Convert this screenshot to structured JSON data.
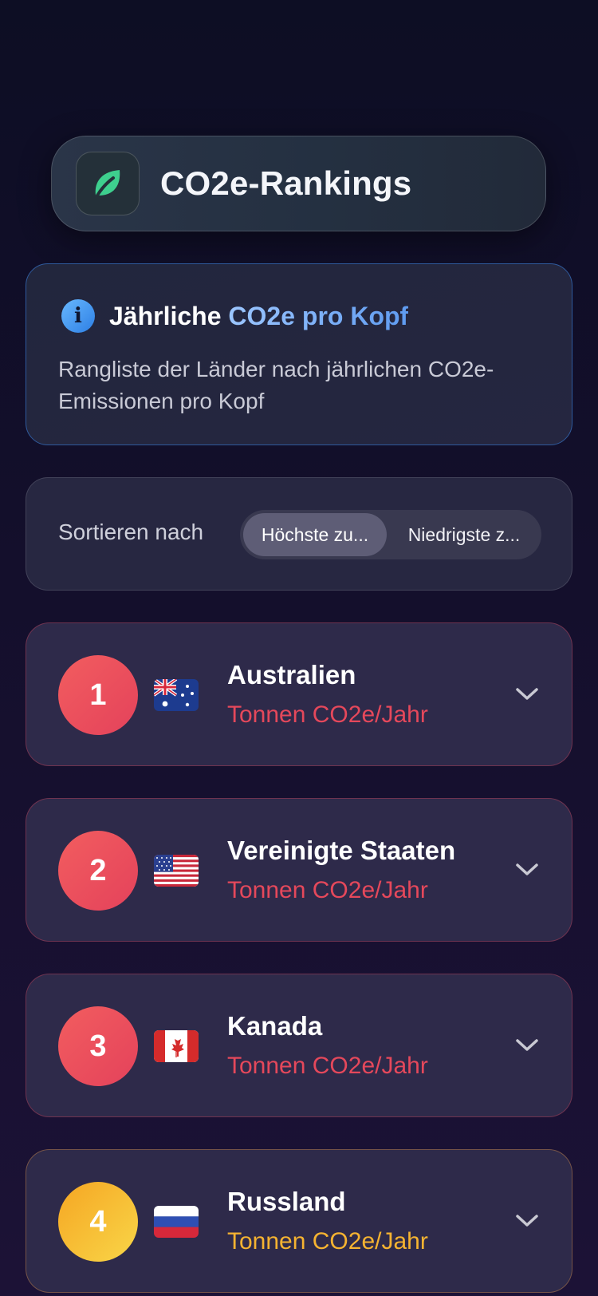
{
  "header": {
    "title": "CO2e-Rankings",
    "icon": "leaf-icon",
    "accent": "#3ecf8e"
  },
  "info": {
    "icon": "info-icon",
    "title_prefix": "Jährliche",
    "title_highlight": "CO2e pro Kopf",
    "description": "Rangliste der Länder nach jährlichen CO2e-Emissionen pro Kopf"
  },
  "sort": {
    "label": "Sortieren nach",
    "options": [
      "Höchste zu...",
      "Niedrigste z..."
    ],
    "selected": "Höchste zu..."
  },
  "countries": [
    {
      "rank": "1",
      "name": "Australien",
      "unit": "Tonnen CO2e/Jahr",
      "flag": "australia-flag-icon",
      "color": "#e5485b"
    },
    {
      "rank": "2",
      "name": "Vereinigte Staaten",
      "unit": "Tonnen CO2e/Jahr",
      "flag": "usa-flag-icon",
      "color": "#e5485b"
    },
    {
      "rank": "3",
      "name": "Kanada",
      "unit": "Tonnen CO2e/Jahr",
      "flag": "canada-flag-icon",
      "color": "#e5485b"
    },
    {
      "rank": "4",
      "name": "Russland",
      "unit": "Tonnen CO2e/Jahr",
      "flag": "russia-flag-icon",
      "color": "#f5b331"
    }
  ]
}
